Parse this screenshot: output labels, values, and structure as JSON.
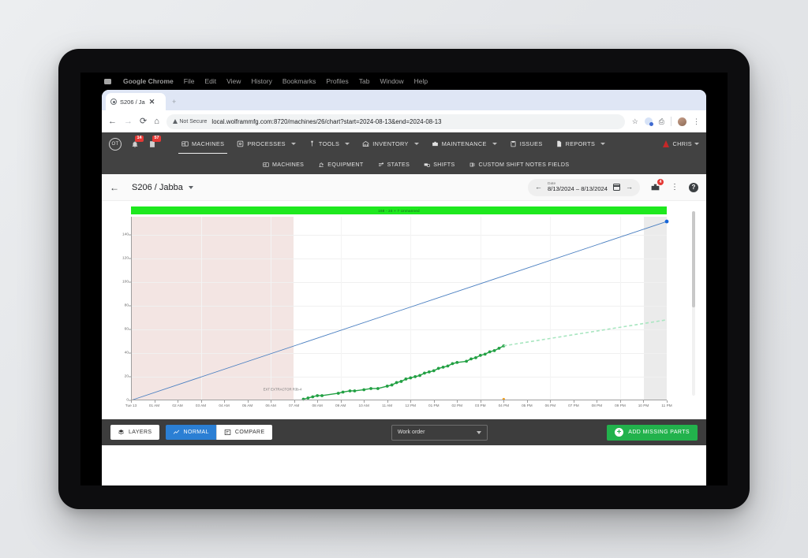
{
  "os_menubar": {
    "app_name": "Google Chrome",
    "items": [
      "File",
      "Edit",
      "View",
      "History",
      "Bookmarks",
      "Profiles",
      "Tab",
      "Window",
      "Help"
    ]
  },
  "browser": {
    "tab_title": "S206 / Ja",
    "new_tab_glyph": "+",
    "back_glyph": "←",
    "forward_glyph": "→",
    "reload_glyph": "⟳",
    "home_glyph": "⌂",
    "security_label": "Not Secure",
    "url": "local.wolframmfg.com:8720/machines/26/chart?start=2024-08-13&end=2024-08-13",
    "star_glyph": "☆",
    "share_glyph": "⎙",
    "kebab_glyph": "⋮",
    "close_glyph": "✕"
  },
  "appnav": {
    "logo_text": "OT",
    "bell_badge": "14",
    "doc_badge": "57",
    "primary": [
      {
        "label": "MACHINES",
        "icon": "machines-icon",
        "active": true,
        "caret": false
      },
      {
        "label": "PROCESSES",
        "icon": "processes-icon",
        "active": false,
        "caret": true
      },
      {
        "label": "TOOLS",
        "icon": "tools-icon",
        "active": false,
        "caret": true
      },
      {
        "label": "INVENTORY",
        "icon": "inventory-icon",
        "active": false,
        "caret": true
      },
      {
        "label": "MAINTENANCE",
        "icon": "maintenance-icon",
        "active": false,
        "caret": true
      },
      {
        "label": "ISSUES",
        "icon": "issues-icon",
        "active": false,
        "caret": false
      },
      {
        "label": "REPORTS",
        "icon": "reports-icon",
        "active": false,
        "caret": true
      }
    ],
    "user": {
      "label": "CHRIS",
      "caret": true
    },
    "secondary": [
      {
        "label": "MACHINES",
        "icon": "machines-icon"
      },
      {
        "label": "EQUIPMENT",
        "icon": "equipment-icon"
      },
      {
        "label": "STATES",
        "icon": "states-icon"
      },
      {
        "label": "SHIFTS",
        "icon": "shifts-icon"
      },
      {
        "label": "CUSTOM SHIFT NOTES FIELDS",
        "icon": "custom-fields-icon"
      }
    ]
  },
  "pageheader": {
    "back_glyph": "←",
    "title": "S206 / Jabba",
    "date_label": "Date",
    "date_value": "8/13/2024 – 8/13/2024",
    "prev_glyph": "←",
    "next_glyph": "→",
    "toolbox_badge": "4",
    "kebab_glyph": "⋮",
    "help_glyph": "?"
  },
  "bottombar": {
    "layers_label": "LAYERS",
    "normal_label": "NORMAL",
    "compare_label": "COMPARE",
    "work_order_label": "Work order",
    "add_missing_parts_label": "ADD MISSING PARTS",
    "plus_glyph": "+",
    "accent_blue": "#2b7fd4",
    "accent_green": "#22b24c"
  },
  "chart_data": {
    "type": "line",
    "title": "",
    "banner_label": "168 - 24 × 7 Unmanned",
    "banner_color": "#1ee81e",
    "xlabel": "",
    "ylabel": "",
    "ylim": [
      0,
      155
    ],
    "yticks": [
      0,
      20,
      40,
      60,
      80,
      100,
      120,
      140
    ],
    "x_categories": [
      "Tue 13",
      "01 AM",
      "02 AM",
      "03 AM",
      "04 AM",
      "05 AM",
      "06 AM",
      "07 AM",
      "08 AM",
      "09 AM",
      "10 AM",
      "11 AM",
      "12 PM",
      "01 PM",
      "02 PM",
      "03 PM",
      "04 PM",
      "05 PM",
      "06 PM",
      "07 PM",
      "08 PM",
      "09 PM",
      "10 PM",
      "11 PM"
    ],
    "grid": true,
    "legend_position": "none",
    "annotations": [
      {
        "text": "EXT EXTRACTOR R3b-4",
        "x_hour": 7.4,
        "y": 3
      }
    ],
    "shaded_regions": [
      {
        "name": "unmanned-early",
        "x_start_hour": 0,
        "x_end_hour": 7.3,
        "color": "#f3e5e3"
      },
      {
        "name": "future-region",
        "x_start_hour": 23,
        "x_end_hour": 24,
        "color": "#ebebeb"
      }
    ],
    "series": [
      {
        "name": "Target",
        "color": "#4a7fc1",
        "style": "solid",
        "marker_end": true,
        "points": [
          {
            "x_hour": 0,
            "y": 0
          },
          {
            "x_hour": 23,
            "y": 151
          }
        ]
      },
      {
        "name": "Actual",
        "color": "#22a043",
        "style": "solid-markers",
        "points": [
          {
            "x_hour": 7.4,
            "y": 1
          },
          {
            "x_hour": 7.6,
            "y": 2
          },
          {
            "x_hour": 7.8,
            "y": 3
          },
          {
            "x_hour": 8.0,
            "y": 4
          },
          {
            "x_hour": 8.2,
            "y": 4
          },
          {
            "x_hour": 8.9,
            "y": 6
          },
          {
            "x_hour": 9.1,
            "y": 7
          },
          {
            "x_hour": 9.4,
            "y": 8
          },
          {
            "x_hour": 9.6,
            "y": 8
          },
          {
            "x_hour": 10.0,
            "y": 9
          },
          {
            "x_hour": 10.3,
            "y": 10
          },
          {
            "x_hour": 10.6,
            "y": 10
          },
          {
            "x_hour": 11.0,
            "y": 12
          },
          {
            "x_hour": 11.2,
            "y": 13
          },
          {
            "x_hour": 11.4,
            "y": 15
          },
          {
            "x_hour": 11.6,
            "y": 16
          },
          {
            "x_hour": 11.8,
            "y": 18
          },
          {
            "x_hour": 12.0,
            "y": 19
          },
          {
            "x_hour": 12.2,
            "y": 20
          },
          {
            "x_hour": 12.4,
            "y": 21
          },
          {
            "x_hour": 12.6,
            "y": 23
          },
          {
            "x_hour": 12.8,
            "y": 24
          },
          {
            "x_hour": 13.0,
            "y": 25
          },
          {
            "x_hour": 13.2,
            "y": 27
          },
          {
            "x_hour": 13.4,
            "y": 28
          },
          {
            "x_hour": 13.6,
            "y": 29
          },
          {
            "x_hour": 13.8,
            "y": 31
          },
          {
            "x_hour": 14.0,
            "y": 32
          },
          {
            "x_hour": 14.4,
            "y": 33
          },
          {
            "x_hour": 14.6,
            "y": 35
          },
          {
            "x_hour": 14.8,
            "y": 36
          },
          {
            "x_hour": 15.0,
            "y": 38
          },
          {
            "x_hour": 15.2,
            "y": 39
          },
          {
            "x_hour": 15.4,
            "y": 41
          },
          {
            "x_hour": 15.6,
            "y": 42
          },
          {
            "x_hour": 15.8,
            "y": 44
          },
          {
            "x_hour": 16.0,
            "y": 46
          }
        ]
      },
      {
        "name": "Projection",
        "color": "#a8e6c0",
        "style": "dashed",
        "points": [
          {
            "x_hour": 16.0,
            "y": 46
          },
          {
            "x_hour": 23.0,
            "y": 68
          }
        ]
      }
    ],
    "markers": [
      {
        "name": "target-end-point",
        "x_hour": 23,
        "y": 151,
        "color": "#1565d8"
      },
      {
        "name": "issue-marker",
        "x_hour": 16.0,
        "y": 1,
        "color": "#f0a020"
      }
    ]
  }
}
